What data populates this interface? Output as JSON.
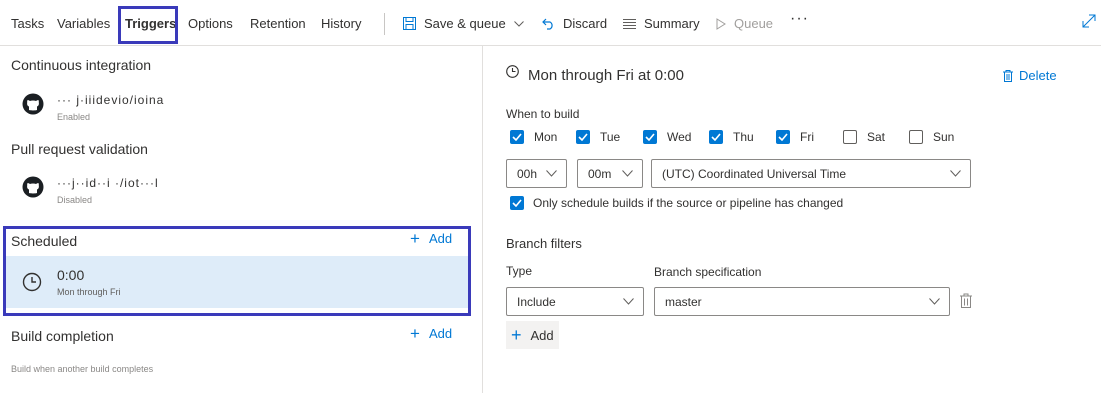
{
  "tabs": [
    {
      "label": "Tasks"
    },
    {
      "label": "Variables"
    },
    {
      "label": "Triggers"
    },
    {
      "label": "Options"
    },
    {
      "label": "Retention"
    },
    {
      "label": "History"
    }
  ],
  "actions": {
    "save_queue": "Save & queue",
    "discard": "Discard",
    "summary": "Summary",
    "queue": "Queue",
    "more": "···"
  },
  "left": {
    "ci_title": "Continuous integration",
    "ci_repo": "··· j·iiidevio/ioina",
    "ci_status": "Enabled",
    "pr_title": "Pull request validation",
    "pr_repo": "···j··id··i ·/iot···l",
    "pr_status": "Disabled",
    "scheduled_title": "Scheduled",
    "scheduled_add": "Add",
    "schedule_time": "0:00",
    "schedule_days": "Mon through Fri",
    "bc_title": "Build completion",
    "bc_add": "Add",
    "bc_desc": "Build when another build completes"
  },
  "right": {
    "title": "Mon through Fri at 0:00",
    "delete": "Delete",
    "when_to_build": "When to build",
    "days": [
      {
        "label": "Mon",
        "checked": true
      },
      {
        "label": "Tue",
        "checked": true
      },
      {
        "label": "Wed",
        "checked": true
      },
      {
        "label": "Thu",
        "checked": true
      },
      {
        "label": "Fri",
        "checked": true
      },
      {
        "label": "Sat",
        "checked": false
      },
      {
        "label": "Sun",
        "checked": false
      }
    ],
    "hour": "00h",
    "minute": "00m",
    "timezone": "(UTC) Coordinated Universal Time",
    "only_schedule": "Only schedule builds if the source or pipeline has changed",
    "only_schedule_checked": true,
    "branch_filters": "Branch filters",
    "type_label": "Type",
    "branch_spec_label": "Branch specification",
    "type_value": "Include",
    "branch_value": "master",
    "add": "Add"
  },
  "colors": {
    "accent": "#0078d4",
    "selected_row": "#deecf9",
    "highlight_box": "#3a3aba"
  }
}
